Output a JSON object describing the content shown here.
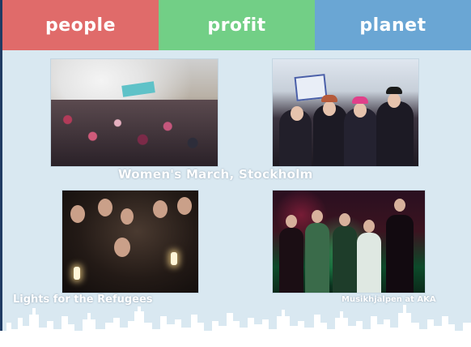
{
  "header": {
    "tabs": [
      {
        "label": "people",
        "color": "#e06b6a"
      },
      {
        "label": "profit",
        "color": "#72cf86"
      },
      {
        "label": "planet",
        "color": "#6aa6d4"
      }
    ]
  },
  "captions": {
    "womens_march": "Women's March, Stockholm",
    "lights": "Lights for the Refugees",
    "musikhjalpen": "Musikhjälpen at AKA"
  },
  "colors": {
    "background": "#d9e8f1",
    "skyline": "#ffffff"
  }
}
